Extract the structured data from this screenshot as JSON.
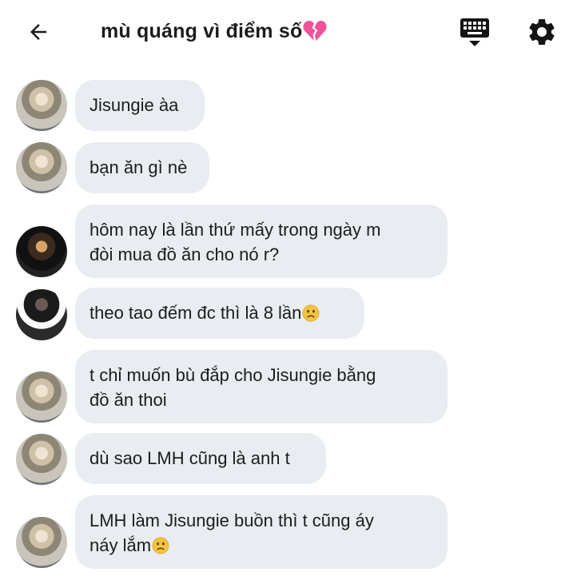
{
  "header": {
    "title": "mù quáng vì điểm số",
    "back_icon": "arrow-left-icon",
    "keyboard_icon": "keyboard-icon",
    "settings_icon": "gear-icon",
    "title_emoji": "broken-heart-icon"
  },
  "messages": [
    {
      "lines": [
        "Jisungie àa"
      ],
      "avatar": "avatar-blonde"
    },
    {
      "lines": [
        "bạn ăn gì nè"
      ],
      "avatar": "avatar-blonde"
    },
    {
      "lines": [
        "hôm nay là lần thứ mấy trong ngày m",
        "đòi mua đồ ăn cho nó r?"
      ],
      "avatar": "avatar-dark-portrait"
    },
    {
      "lines": [
        "theo tao đếm đc thì là 8 lần"
      ],
      "avatar": "avatar-sunglasses",
      "trailing_emoji": "slightly-frowning-face-icon"
    },
    {
      "lines": [
        "t chỉ muốn bù đắp cho Jisungie bằng",
        "đồ ăn thoi"
      ],
      "avatar": "avatar-blonde"
    },
    {
      "lines": [
        "dù sao LMH cũng là anh t"
      ],
      "avatar": "avatar-blonde"
    },
    {
      "lines": [
        "LMH làm Jisungie buồn thì t cũng áy",
        "náy lắm"
      ],
      "avatar": "avatar-blonde",
      "trailing_emoji": "slightly-frowning-face-icon"
    }
  ],
  "colors": {
    "bubble": "#e9edf1",
    "text": "#1c1c1c",
    "broken_heart": "#f0529a",
    "emoji": "#f5c242"
  }
}
